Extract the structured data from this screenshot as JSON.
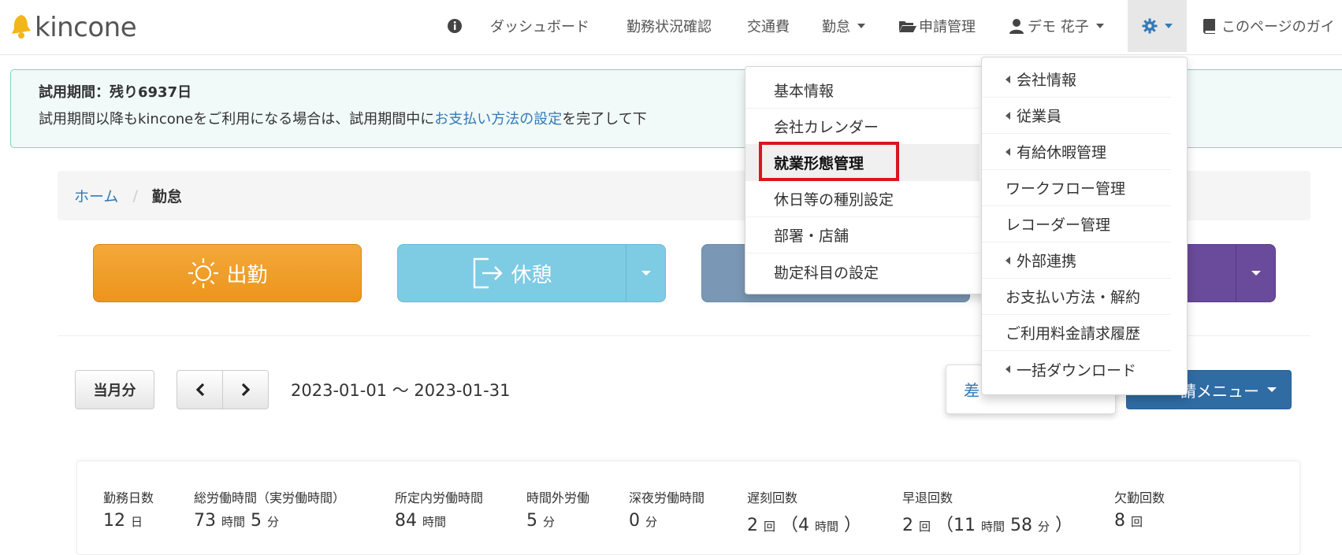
{
  "nav": {
    "logo_text": "kincone",
    "items": [
      "ダッシュボード",
      "勤務状況確認",
      "交通費",
      "勤怠",
      "申請管理",
      "デモ 花子",
      "このページのガイ"
    ]
  },
  "trial": {
    "title": "試用期間：残り6937日",
    "text_before": "試用期間以降もkinconeをご利用になる場合は、試用期間中に",
    "link": "お支払い方法の設定",
    "text_after": "を完了して下"
  },
  "breadcrumb": {
    "home": "ホーム",
    "separator": "/",
    "current": "勤怠"
  },
  "actions": {
    "clock_in": "出勤",
    "break": "休憩"
  },
  "period": {
    "month_button": "当月分",
    "range": "2023-01-01 〜 2023-01-31",
    "diff_button": "差",
    "apply_menu": "請メニュー"
  },
  "summary": [
    {
      "label": "勤務日数",
      "value": "12",
      "unit": "日"
    },
    {
      "label": "総労働時間（実労働時間）",
      "value": "73",
      "unit": "時間",
      "value2": "5",
      "unit2": "分"
    },
    {
      "label": "所定内労働時間",
      "value": "84",
      "unit": "時間"
    },
    {
      "label": "時間外労働",
      "value": "5",
      "unit": "分"
    },
    {
      "label": "深夜労働時間",
      "value": "0",
      "unit": "分"
    },
    {
      "label": "遅刻回数",
      "value": "2",
      "unit": "回",
      "extra": "（4",
      "extra_unit": "時間",
      "extra_end": "）"
    },
    {
      "label": "早退回数",
      "value": "2",
      "unit": "回",
      "extra": "（11",
      "extra_unit": "時間",
      "extra2": "58",
      "extra2_unit": "分",
      "extra_end": "）"
    },
    {
      "label": "欠勤回数",
      "value": "8",
      "unit": "回"
    }
  ],
  "menu_left": [
    "基本情報",
    "会社カレンダー",
    "就業形態管理",
    "休日等の種別設定",
    "部署・店舗",
    "勘定科目の設定"
  ],
  "menu_right": [
    {
      "label": "会社情報",
      "submenu": true
    },
    {
      "label": "従業員",
      "submenu": true
    },
    {
      "label": "有給休暇管理",
      "submenu": true
    },
    {
      "label": "ワークフロー管理",
      "submenu": false
    },
    {
      "label": "レコーダー管理",
      "submenu": false
    },
    {
      "label": "外部連携",
      "submenu": true
    },
    {
      "label": "お支払い方法・解約",
      "submenu": false
    },
    {
      "label": "ご利用料金請求履歴",
      "submenu": false
    },
    {
      "label": "一括ダウンロード",
      "submenu": true
    }
  ],
  "colors": {
    "accent": "#337ab7",
    "clock_in": "#ef9b24",
    "break": "#7ecbe4",
    "highlight": "#d9161e"
  }
}
